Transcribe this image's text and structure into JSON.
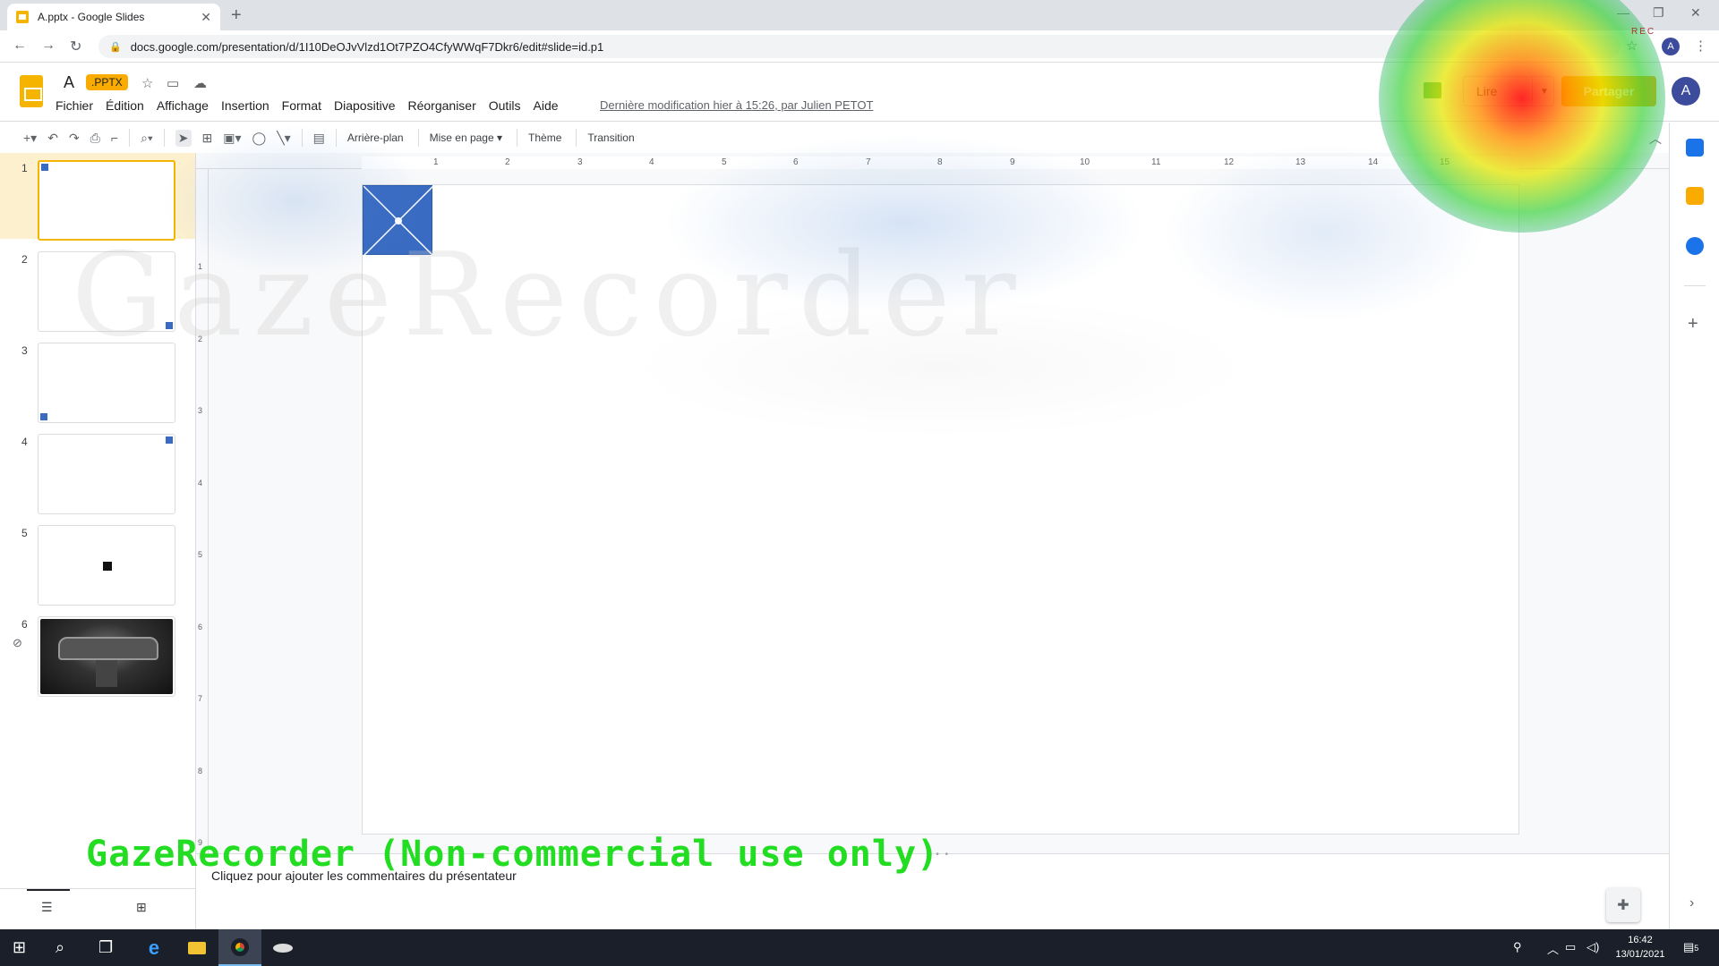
{
  "browser": {
    "tab_title": "A.pptx - Google Slides",
    "tab_close": "✕",
    "new_tab": "+",
    "url": "docs.google.com/presentation/d/1I10DeOJvVlzd1Ot7PZO4CfyWWqF7Dkr6/edit#slide=id.p1",
    "profile_initial": "A",
    "rec_label": "REC"
  },
  "header": {
    "doc_title": "A",
    "format_badge": ".PPTX",
    "menus": [
      "Fichier",
      "Édition",
      "Affichage",
      "Insertion",
      "Format",
      "Diapositive",
      "Réorganiser",
      "Outils",
      "Aide"
    ],
    "last_modified": "Dernière modification hier à 15:26, par Julien PETOT",
    "present_label": "Lire",
    "share_label": "Partager",
    "account_initial": "A"
  },
  "toolbar": {
    "background_label": "Arrière-plan",
    "layout_label": "Mise en page",
    "theme_label": "Thème",
    "transition_label": "Transition"
  },
  "filmstrip": {
    "slides": [
      {
        "num": "1",
        "content": "blue-marker-top-left",
        "selected": true
      },
      {
        "num": "2",
        "content": "blue-marker-bottom-right",
        "selected": false
      },
      {
        "num": "3",
        "content": "blue-marker-bottom-left",
        "selected": false
      },
      {
        "num": "4",
        "content": "blue-marker-top-right",
        "selected": false
      },
      {
        "num": "5",
        "content": "black-square-center",
        "selected": false
      },
      {
        "num": "6",
        "content": "car-interior-photo",
        "selected": false
      }
    ]
  },
  "ruler": {
    "top": [
      "1",
      "2",
      "3",
      "4",
      "5",
      "6",
      "7",
      "8",
      "9",
      "10",
      "11",
      "12",
      "13",
      "14",
      "15"
    ],
    "left": [
      "1",
      "2",
      "3",
      "4",
      "5",
      "6",
      "7",
      "8",
      "9"
    ]
  },
  "editor": {
    "watermark": "GazeRecorder",
    "notes_placeholder": "Cliquez pour ajouter les commentaires du présentateur",
    "overlay_text": "GazeRecorder (Non-commercial use only)"
  },
  "taskbar": {
    "time": "16:42",
    "date": "13/01/2021",
    "notifications": "5"
  },
  "colors": {
    "slides_yellow": "#f4b400",
    "accent_blue": "#3a6bc2",
    "overlay_green": "#22dd22"
  }
}
